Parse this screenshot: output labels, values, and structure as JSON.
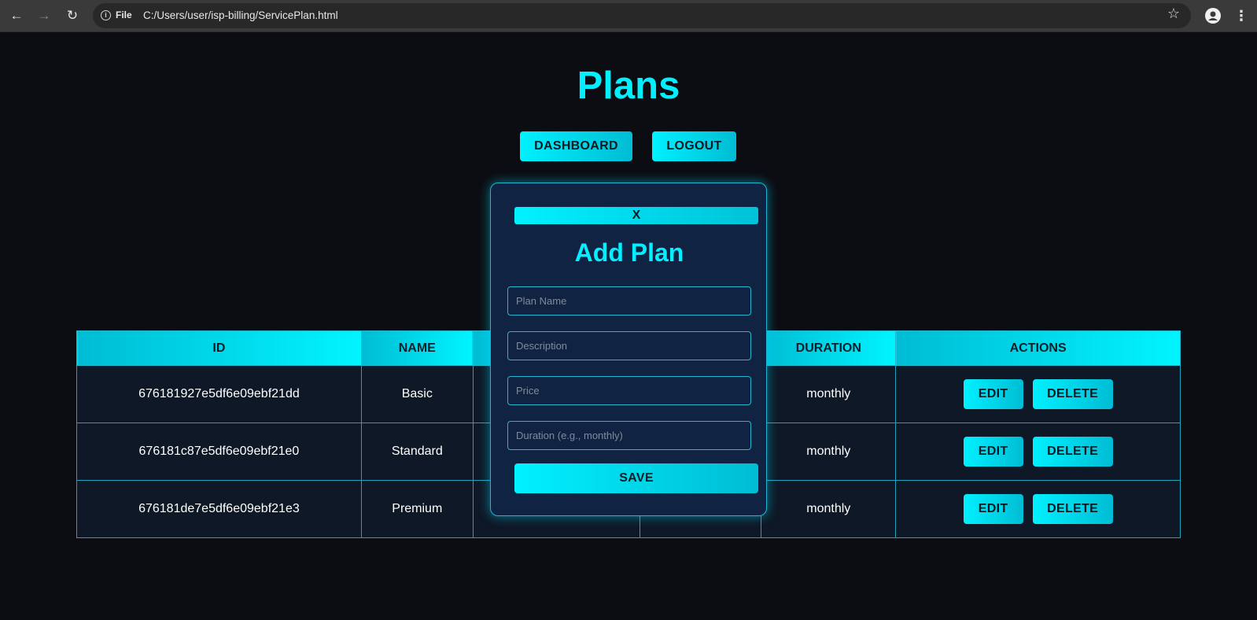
{
  "browser": {
    "file_label": "File",
    "url": "C:/Users/user/isp-billing/ServicePlan.html"
  },
  "page": {
    "title": "Plans",
    "dashboard_label": "DASHBOARD",
    "logout_label": "LOGOUT"
  },
  "table": {
    "headers": [
      "ID",
      "NAME",
      "",
      "",
      "DURATION",
      "ACTIONS"
    ],
    "rows": [
      {
        "id": "676181927e5df6e09ebf21dd",
        "name": "Basic",
        "duration": "monthly"
      },
      {
        "id": "676181c87e5df6e09ebf21e0",
        "name": "Standard",
        "duration": "monthly"
      },
      {
        "id": "676181de7e5df6e09ebf21e3",
        "name": "Premium",
        "duration": "monthly"
      }
    ],
    "edit_label": "EDIT",
    "delete_label": "DELETE"
  },
  "modal": {
    "close_label": "X",
    "title": "Add Plan",
    "fields": {
      "name_placeholder": "Plan Name",
      "description_placeholder": "Description",
      "price_placeholder": "Price",
      "duration_placeholder": "Duration (e.g., monthly)"
    },
    "save_label": "SAVE"
  },
  "colors": {
    "accent": "#00f0ff",
    "background": "#0b0d12",
    "modal_bg": "#112342"
  }
}
